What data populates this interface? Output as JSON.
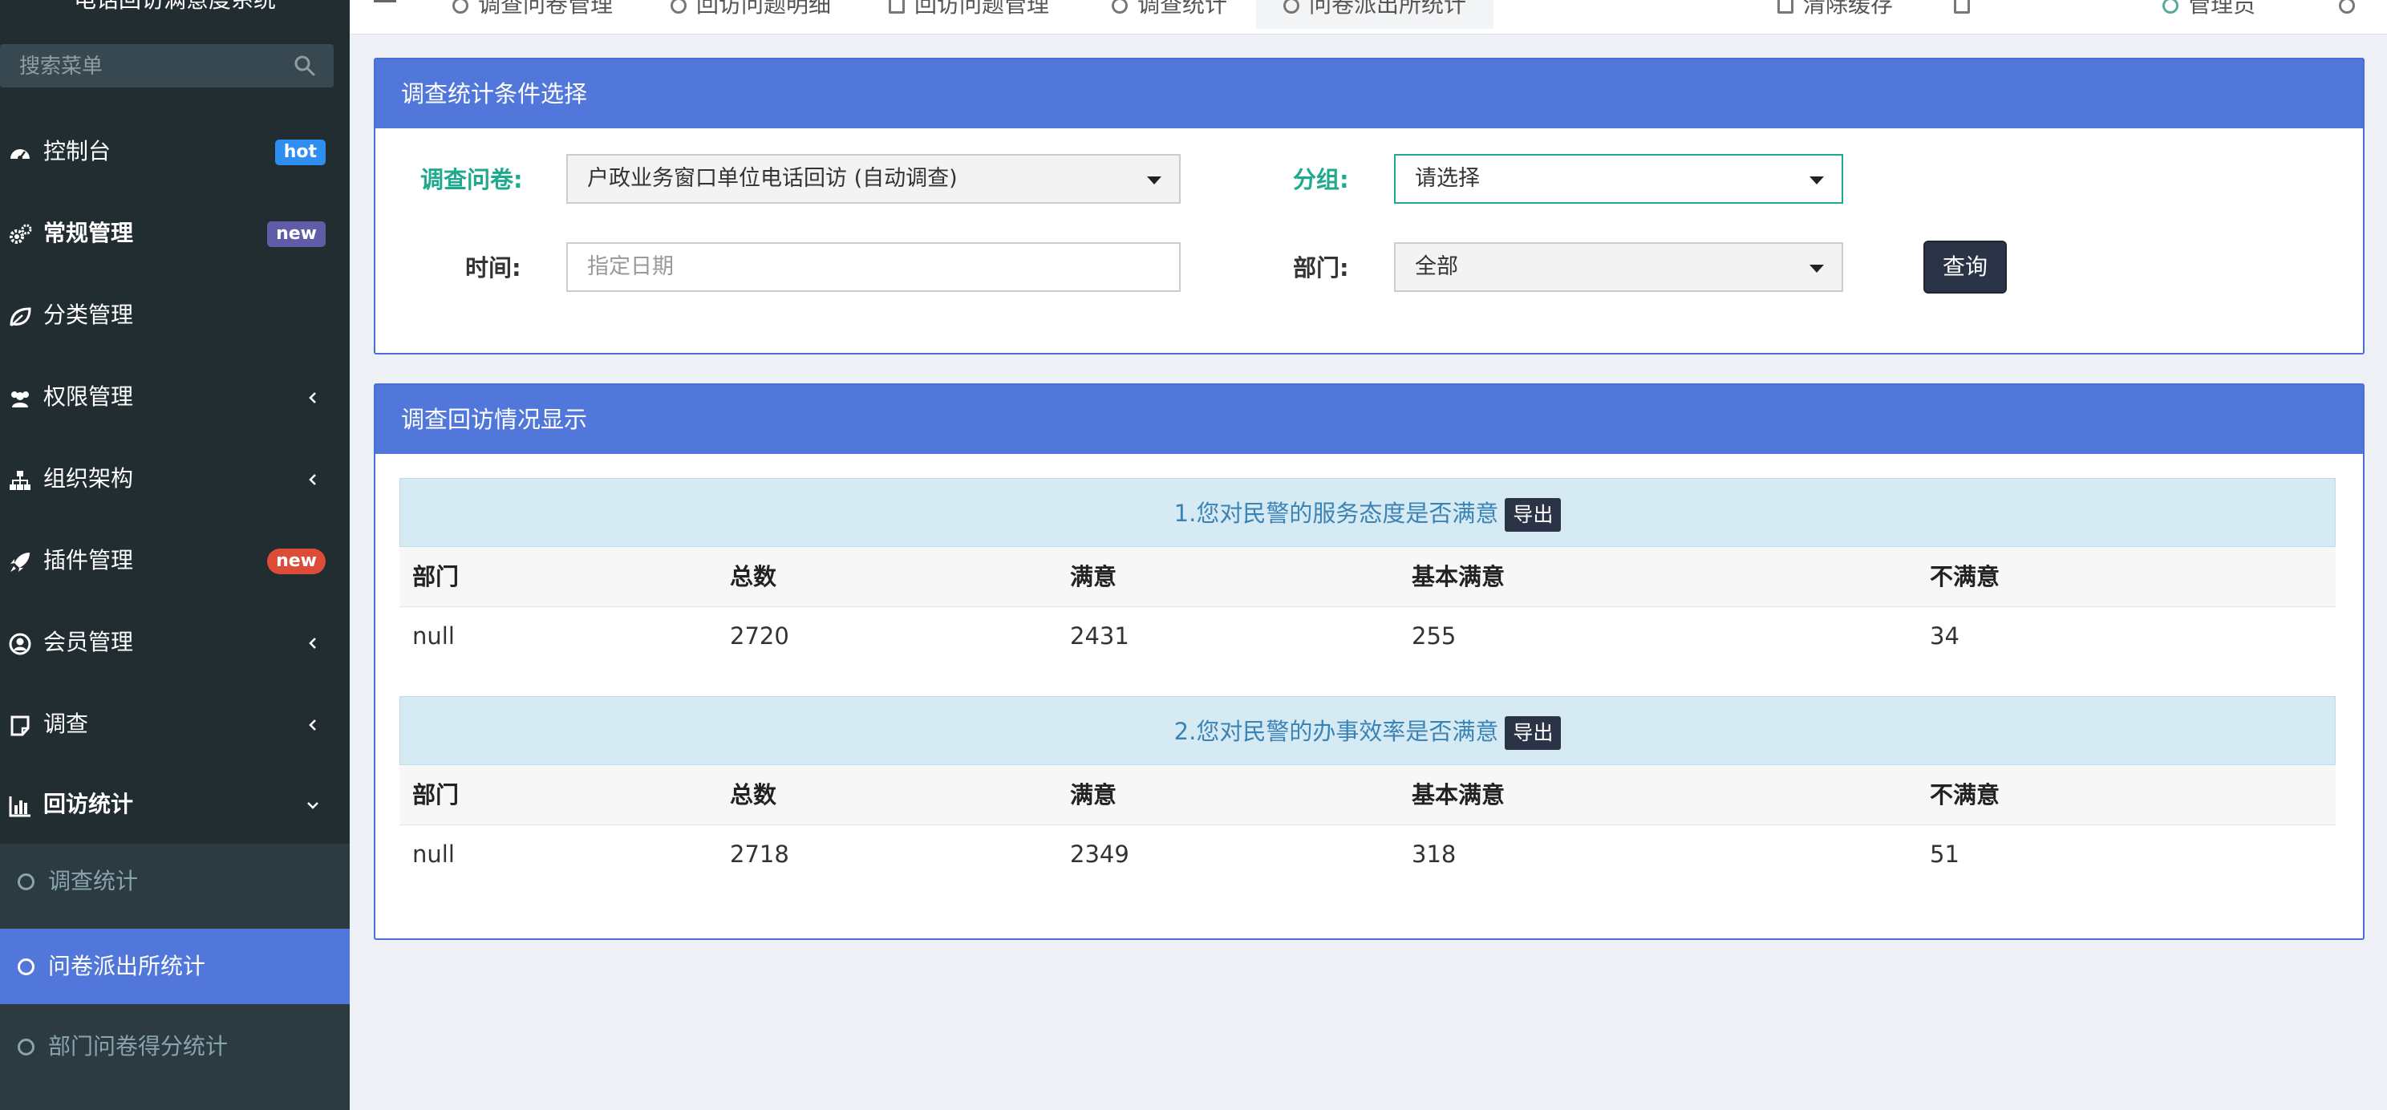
{
  "sidebar": {
    "title": "电话回访满意度系统",
    "search_placeholder": "搜索菜单",
    "menu": [
      {
        "label": "控制台",
        "icon": "dashboard-icon",
        "badge": "hot"
      },
      {
        "label": "常规管理",
        "icon": "cogs-icon",
        "badge": "new"
      },
      {
        "label": "分类管理",
        "icon": "leaf-icon"
      },
      {
        "label": "权限管理",
        "icon": "users-icon"
      },
      {
        "label": "组织架构",
        "icon": "sitemap-icon"
      },
      {
        "label": "插件管理",
        "icon": "rocket-icon",
        "badge": "new"
      },
      {
        "label": "会员管理",
        "icon": "user-circle-icon"
      },
      {
        "label": "调查",
        "icon": "note-icon"
      },
      {
        "label": "回访统计",
        "icon": "bar-chart-icon"
      }
    ],
    "submenu": [
      {
        "label": "调查统计"
      },
      {
        "label": "问卷派出所统计"
      },
      {
        "label": "部门问卷得分统计"
      }
    ]
  },
  "topnav": {
    "tabs": [
      "调查问卷管理",
      "回访问题明细",
      "回访问题管理",
      "调查统计",
      "问卷派出所统计"
    ],
    "right": [
      "清除缓存",
      "管理员"
    ]
  },
  "filter_panel": {
    "title": "调查统计条件选择",
    "questionnaire_label": "调查问卷:",
    "questionnaire_value": "户政业务窗口单位电话回访 (自动调查)",
    "group_label": "分组:",
    "group_value": "请选择",
    "time_label": "时间:",
    "time_placeholder": "指定日期",
    "dept_label": "部门:",
    "dept_value": "全部",
    "query_button": "查询"
  },
  "results_panel": {
    "title": "调查回访情况显示",
    "export_label": "导出",
    "columns": [
      "部门",
      "总数",
      "满意",
      "基本满意",
      "不满意"
    ],
    "questions": [
      {
        "title": "1.您对民警的服务态度是否满意",
        "rows": [
          [
            "null",
            "2720",
            "2431",
            "255",
            "34"
          ]
        ]
      },
      {
        "title": "2.您对民警的办事效率是否满意",
        "rows": [
          [
            "null",
            "2718",
            "2349",
            "318",
            "51"
          ]
        ]
      }
    ]
  }
}
